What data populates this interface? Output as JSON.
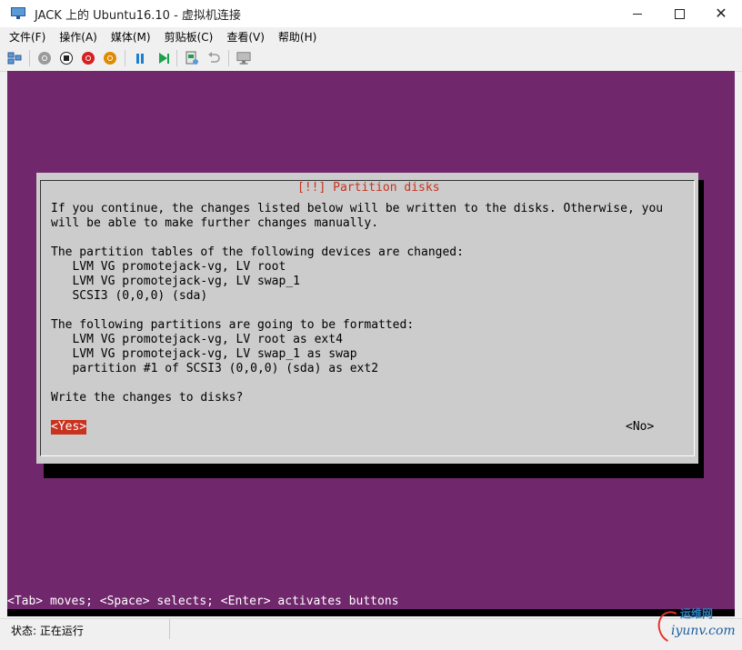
{
  "window": {
    "title": "JACK 上的 Ubuntu16.10 - 虚拟机连接",
    "controls": {
      "minimize": "minimize",
      "maximize": "maximize",
      "close": "✕"
    }
  },
  "menu": [
    {
      "label": "文件(F)"
    },
    {
      "label": "操作(A)"
    },
    {
      "label": "媒体(M)"
    },
    {
      "label": "剪贴板(C)"
    },
    {
      "label": "查看(V)"
    },
    {
      "label": "帮助(H)"
    }
  ],
  "toolbar": {
    "icons": [
      "ctrl-alt-del-icon",
      "start-icon",
      "turn-off-icon",
      "shutdown-icon",
      "save-icon",
      "pause-icon",
      "resume-icon",
      "checkpoint-icon",
      "revert-icon",
      "enhanced-session-icon"
    ]
  },
  "installer": {
    "dialog_title": "[!!] Partition disks",
    "lines": [
      "If you continue, the changes listed below will be written to the disks. Otherwise, you",
      "will be able to make further changes manually.",
      "",
      "The partition tables of the following devices are changed:",
      "   LVM VG promotejack-vg, LV root",
      "   LVM VG promotejack-vg, LV swap_1",
      "   SCSI3 (0,0,0) (sda)",
      "",
      "The following partitions are going to be formatted:",
      "   LVM VG promotejack-vg, LV root as ext4",
      "   LVM VG promotejack-vg, LV swap_1 as swap",
      "   partition #1 of SCSI3 (0,0,0) (sda) as ext2",
      "",
      "Write the changes to disks?"
    ],
    "yes_label": "<Yes>",
    "no_label": "<No>",
    "help_line": "<Tab> moves; <Space> selects; <Enter> activates buttons"
  },
  "status": {
    "text": "状态: 正在运行"
  },
  "watermark": {
    "text": "运维网",
    "sub": "iyunv.com"
  },
  "colors": {
    "vm_background": "#70276c",
    "dialog_background": "#cccccc",
    "title_red": "#c8321e",
    "selected_button": "#c8321e"
  }
}
